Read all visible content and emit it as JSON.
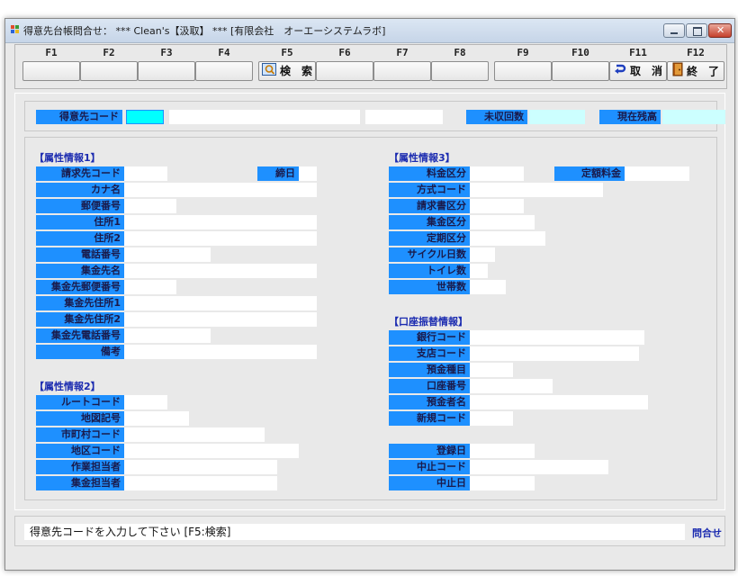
{
  "window": {
    "title": "得意先台帳問合せ： *** Clean's【汲取】 *** [有限会社　オーエーシステムラボ]"
  },
  "fkeys": [
    {
      "key": "F1",
      "label": ""
    },
    {
      "key": "F2",
      "label": ""
    },
    {
      "key": "F3",
      "label": ""
    },
    {
      "key": "F4",
      "label": ""
    },
    {
      "key": "F5",
      "label": "検　索",
      "icon": "search-icon"
    },
    {
      "key": "F6",
      "label": ""
    },
    {
      "key": "F7",
      "label": ""
    },
    {
      "key": "F8",
      "label": ""
    },
    {
      "key": "F9",
      "label": ""
    },
    {
      "key": "F10",
      "label": ""
    },
    {
      "key": "F11",
      "label": "取　消",
      "icon": "undo-arrow-icon"
    },
    {
      "key": "F12",
      "label": "終　了",
      "icon": "exit-door-icon"
    }
  ],
  "header": {
    "customer_code": "得意先コード",
    "uncollected_count": "未収回数",
    "current_balance": "現在残高"
  },
  "attr1": {
    "title": "【属性情報1】",
    "billing_code": "請求先コード",
    "closing_day": "締日",
    "kana": "カナ名",
    "postal": "郵便番号",
    "address1": "住所1",
    "address2": "住所2",
    "phone": "電話番号",
    "collect_name": "集金先名",
    "collect_postal": "集金先郵便番号",
    "collect_addr1": "集金先住所1",
    "collect_addr2": "集金先住所2",
    "collect_phone": "集金先電話番号",
    "remarks": "備考"
  },
  "attr2": {
    "title": "【属性情報2】",
    "route_code": "ルートコード",
    "map_symbol": "地図記号",
    "city_code": "市町村コード",
    "district_code": "地区コード",
    "staff": "作業担当者",
    "collector": "集金担当者"
  },
  "attr3": {
    "title": "【属性情報3】",
    "fee_type": "料金区分",
    "fixed_fee": "定額料金",
    "method_code": "方式コード",
    "invoice_type": "請求書区分",
    "collect_type": "集金区分",
    "periodic_type": "定期区分",
    "cycle_days": "サイクル日数",
    "toilet_count": "トイレ数",
    "household_count": "世帯数"
  },
  "bank": {
    "title": "【口座振替情報】",
    "bank_code": "銀行コード",
    "branch_code": "支店コード",
    "deposit_type": "預金種目",
    "account_no": "口座番号",
    "account_name": "預金者名",
    "new_code": "新規コード"
  },
  "reg": {
    "registered": "登録日",
    "stop_code": "中止コード",
    "stop_date": "中止日"
  },
  "status": {
    "message": "得意先コードを入力して下さい [F5:検索]",
    "mode": "問合せ"
  }
}
